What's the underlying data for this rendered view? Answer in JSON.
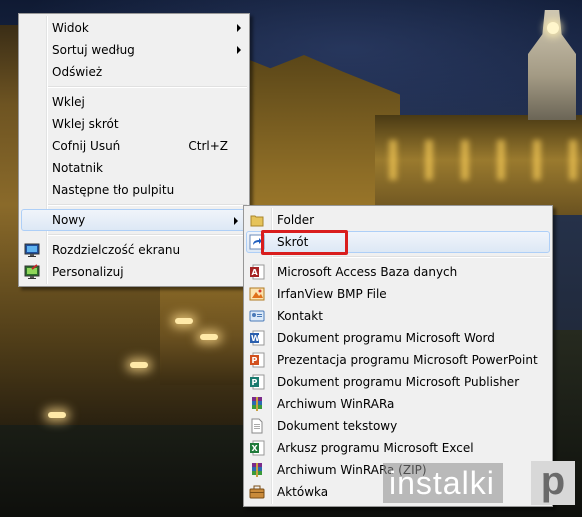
{
  "context_menu": {
    "groups": [
      [
        {
          "label": "Widok",
          "submenu": true
        },
        {
          "label": "Sortuj według",
          "submenu": true
        },
        {
          "label": "Odśwież"
        }
      ],
      [
        {
          "label": "Wklej"
        },
        {
          "label": "Wklej skrót"
        },
        {
          "label": "Cofnij Usuń",
          "shortcut": "Ctrl+Z"
        },
        {
          "label": "Notatnik"
        },
        {
          "label": "Następne tło pulpitu"
        }
      ],
      [
        {
          "label": "Nowy",
          "submenu": true,
          "highlighted": true
        }
      ],
      [
        {
          "label": "Rozdzielczość ekranu",
          "icon": "display-icon"
        },
        {
          "label": "Personalizuj",
          "icon": "personalize-icon"
        }
      ]
    ]
  },
  "new_submenu": {
    "items": [
      {
        "label": "Folder",
        "icon": "folder-icon"
      },
      {
        "label": "Skrót",
        "icon": "shortcut-icon",
        "highlighted": true
      },
      {
        "separator": true
      },
      {
        "label": "Microsoft Access Baza danych",
        "icon": "access-icon"
      },
      {
        "label": "IrfanView BMP File",
        "icon": "bmp-icon"
      },
      {
        "label": "Kontakt",
        "icon": "contact-icon"
      },
      {
        "label": "Dokument programu Microsoft Word",
        "icon": "word-icon"
      },
      {
        "label": "Prezentacja programu Microsoft PowerPoint",
        "icon": "powerpoint-icon"
      },
      {
        "label": "Dokument programu Microsoft Publisher",
        "icon": "publisher-icon"
      },
      {
        "label": "Archiwum WinRARa",
        "icon": "winrar-icon"
      },
      {
        "label": "Dokument tekstowy",
        "icon": "text-document-icon"
      },
      {
        "label": "Arkusz programu Microsoft Excel",
        "icon": "excel-icon"
      },
      {
        "label": "Archiwum WinRARa (ZIP)",
        "icon": "winrar-zip-icon"
      },
      {
        "label": "Aktówka",
        "icon": "briefcase-icon"
      }
    ]
  },
  "watermark": {
    "text": "instalki",
    "letter": "p"
  },
  "colors": {
    "menu_bg": "#f0f0f0",
    "highlight_border": "#aecff7",
    "annotation_red": "#d91d1d"
  }
}
